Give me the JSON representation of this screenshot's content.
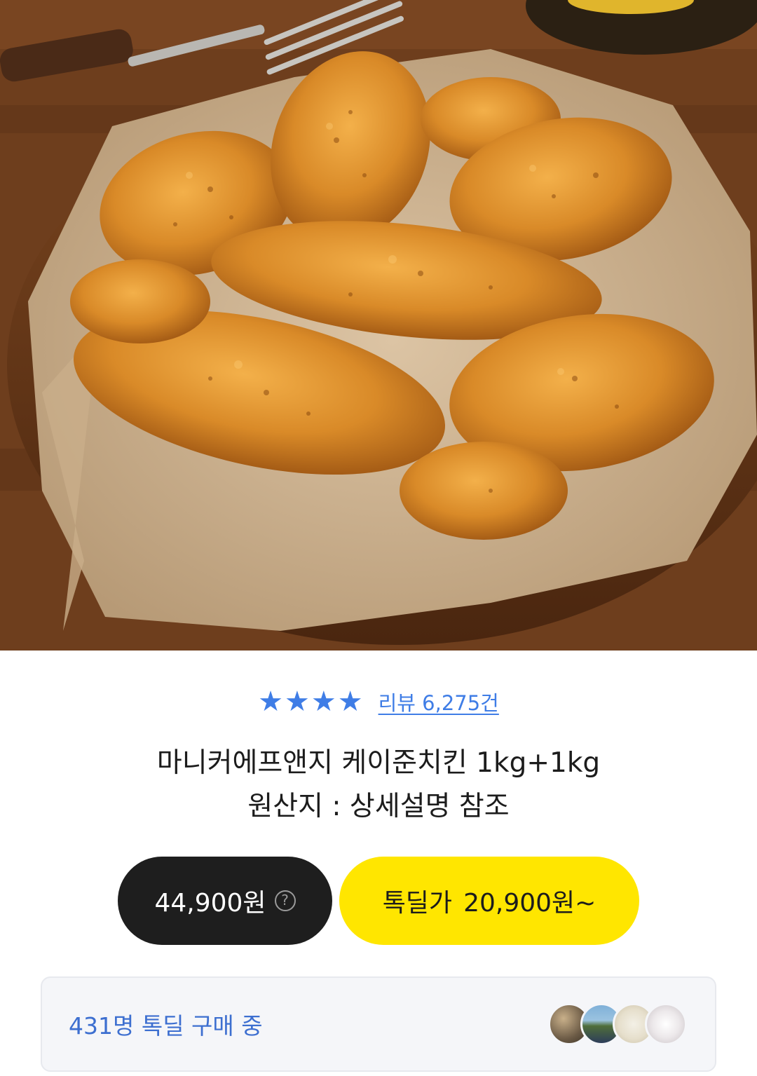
{
  "product": {
    "image_icon": "fried-chicken-photo",
    "rating_stars": 4,
    "star_glyph": "★",
    "review_label": "리뷰 6,275건",
    "title_line1": "마니커에프앤지 케이준치킨 1kg+1kg",
    "title_line2": "원산지 : 상세설명 참조"
  },
  "pricing": {
    "original_price": "44,900원",
    "help_glyph": "?",
    "deal_label": "톡딜가",
    "deal_price": "20,900원~"
  },
  "buyers": {
    "text": "431명 톡딜 구매 중"
  },
  "colors": {
    "accent_blue": "#3f7de6",
    "deal_yellow": "#ffe600",
    "dark_button": "#1e1e1e"
  }
}
